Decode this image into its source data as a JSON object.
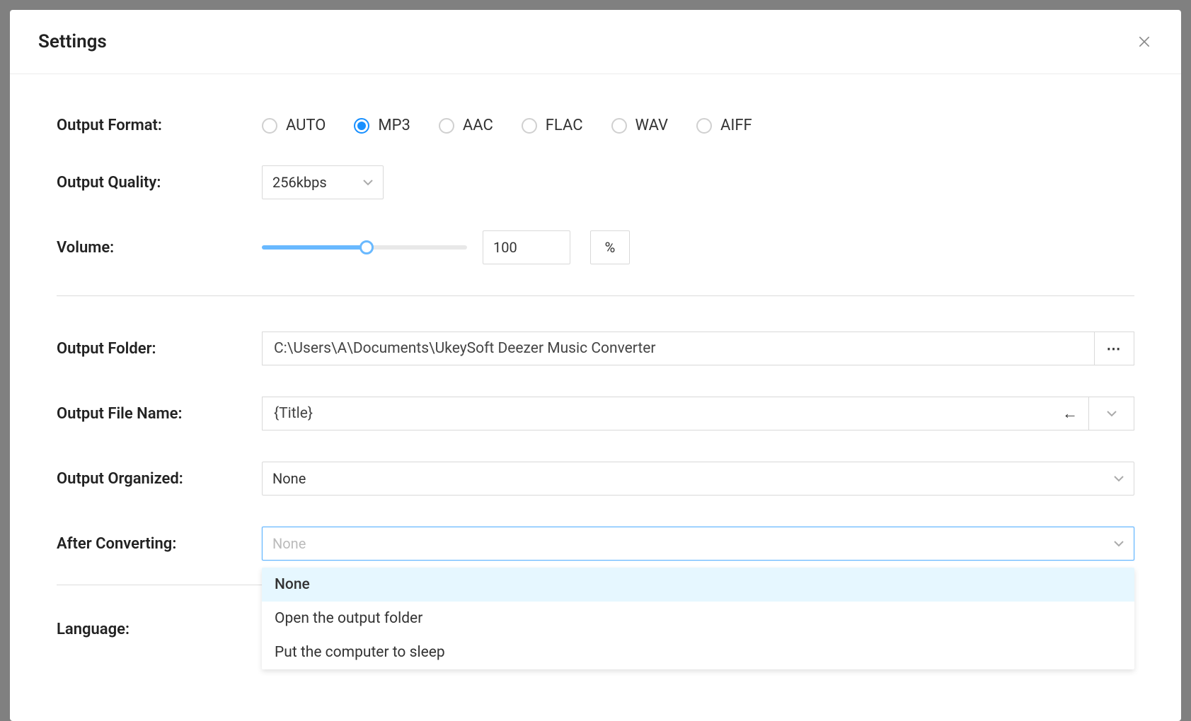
{
  "title": "Settings",
  "labels": {
    "output_format": "Output Format:",
    "output_quality": "Output Quality:",
    "volume": "Volume:",
    "output_folder": "Output Folder:",
    "output_file_name": "Output File Name:",
    "output_organized": "Output Organized:",
    "after_converting": "After Converting:",
    "language": "Language:"
  },
  "format_options": [
    "AUTO",
    "MP3",
    "AAC",
    "FLAC",
    "WAV",
    "AIFF"
  ],
  "format_selected": "MP3",
  "quality": "256kbps",
  "volume": {
    "value": "100",
    "unit": "%"
  },
  "output_folder": "C:\\Users\\A\\Documents\\UkeySoft Deezer Music Converter",
  "output_file_name": "{Title}",
  "output_organized": "None",
  "after_converting_value": "None",
  "after_converting_options": [
    "None",
    "Open the output folder",
    "Put the computer to sleep"
  ]
}
